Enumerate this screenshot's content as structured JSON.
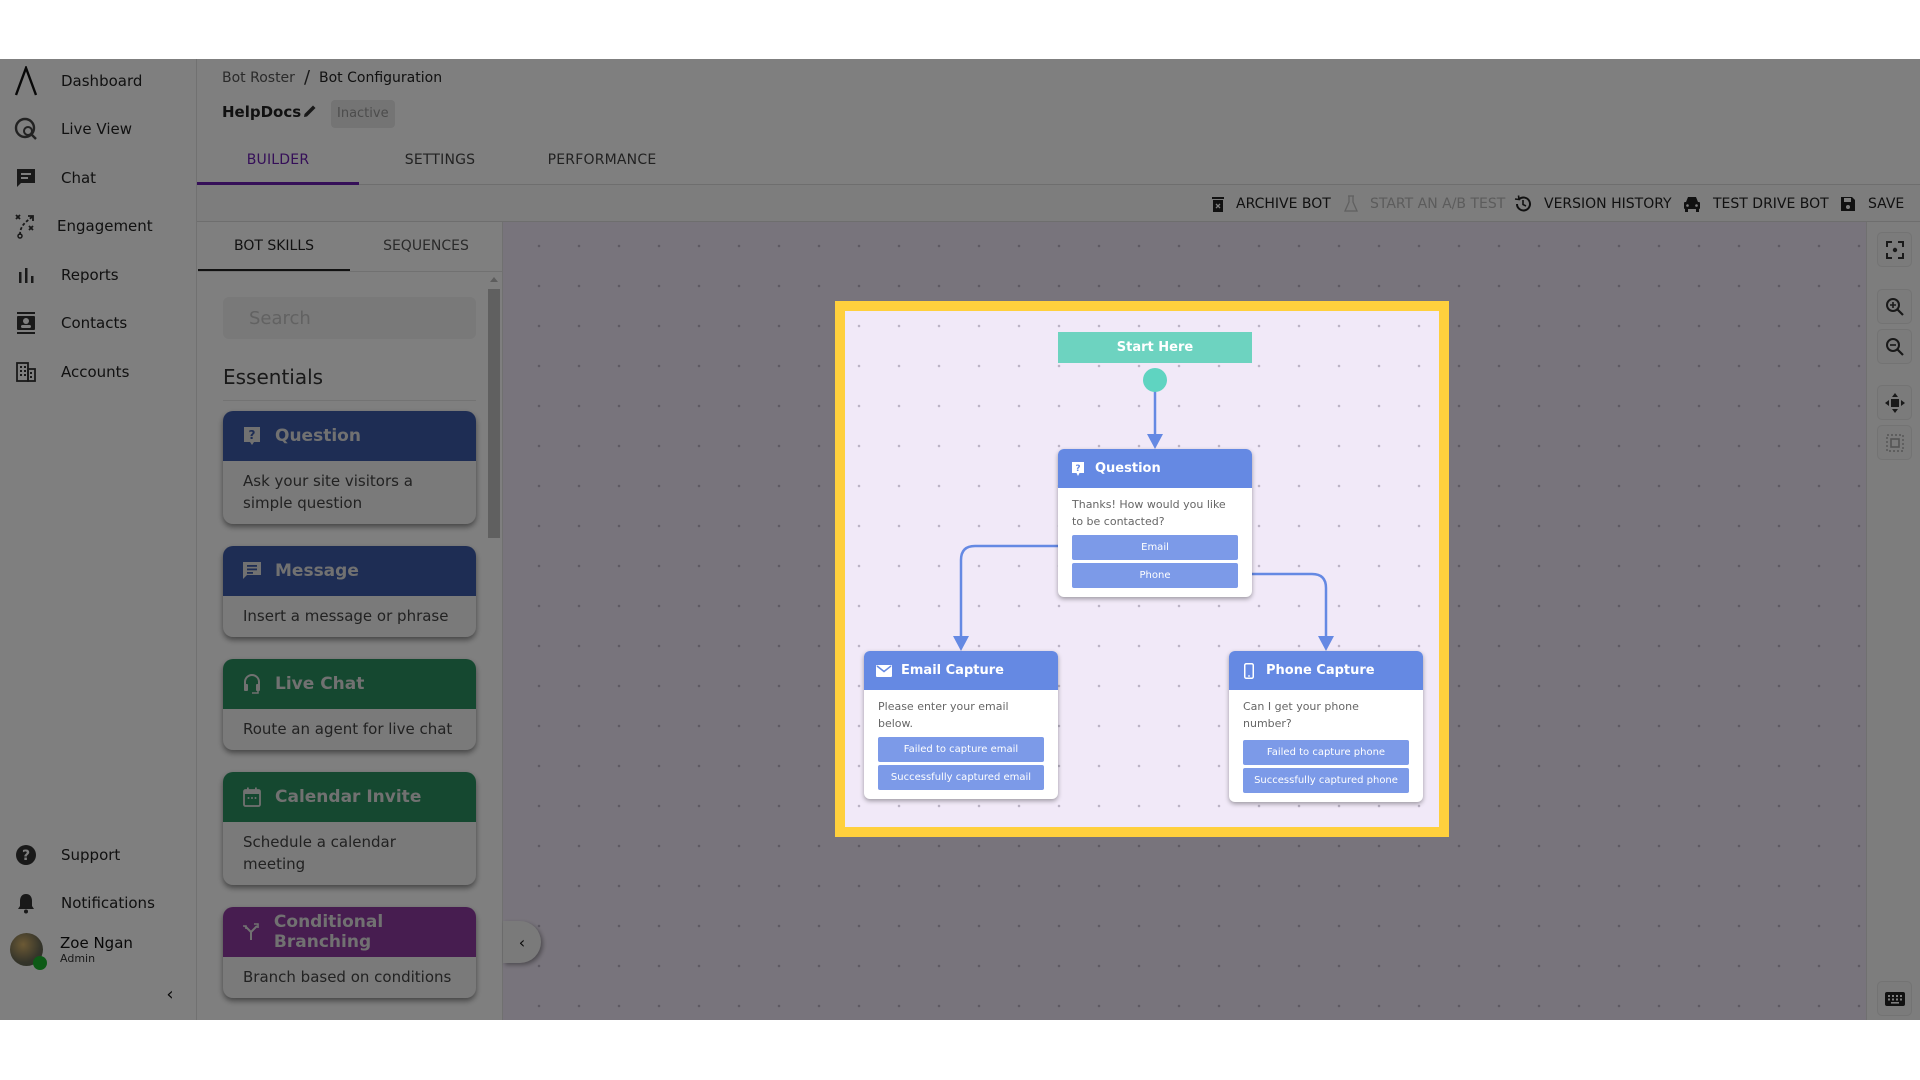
{
  "sidebar": {
    "items": [
      {
        "label": "Dashboard",
        "icon": "logo-icon"
      },
      {
        "label": "Live View",
        "icon": "live-view-icon"
      },
      {
        "label": "Chat",
        "icon": "chat-icon"
      },
      {
        "label": "Engagement",
        "icon": "engagement-icon"
      },
      {
        "label": "Reports",
        "icon": "bar-chart-icon"
      },
      {
        "label": "Contacts",
        "icon": "contacts-icon"
      },
      {
        "label": "Accounts",
        "icon": "building-icon"
      }
    ],
    "bottom_items": [
      {
        "label": "Support",
        "icon": "help-icon"
      },
      {
        "label": "Notifications",
        "icon": "bell-icon"
      }
    ],
    "user": {
      "name": "Zoe Ngan",
      "role": "Admin",
      "status_color": "#1bb52d"
    },
    "collapse_icon": "‹"
  },
  "header": {
    "breadcrumb": [
      "Bot Roster",
      "Bot Configuration"
    ],
    "breadcrumb_separator": "/",
    "bot_name": "HelpDocs",
    "status": "Inactive",
    "tabs": [
      {
        "label": "BUILDER",
        "active": true
      },
      {
        "label": "SETTINGS",
        "active": false
      },
      {
        "label": "PERFORMANCE",
        "active": false
      }
    ],
    "accent_color": "#6a1fb1"
  },
  "toolbar": {
    "archive": "ARCHIVE BOT",
    "ab_test": "START AN A/B TEST",
    "version_history": "VERSION HISTORY",
    "test_drive": "TEST DRIVE BOT",
    "save": "SAVE"
  },
  "panel": {
    "tabs": [
      {
        "label": "BOT SKILLS",
        "active": true
      },
      {
        "label": "SEQUENCES",
        "active": false
      }
    ],
    "search_placeholder": "Search",
    "section_title": "Essentials",
    "skills": [
      {
        "title": "Question",
        "desc": "Ask your site visitors a simple question",
        "color": "#3d5aa8",
        "icon": "question-icon"
      },
      {
        "title": "Message",
        "desc": "Insert a message or phrase",
        "color": "#3d5aa8",
        "icon": "message-icon"
      },
      {
        "title": "Live Chat",
        "desc": "Route an agent for live chat",
        "color": "#2a9160",
        "icon": "headset-icon"
      },
      {
        "title": "Calendar Invite",
        "desc": "Schedule a calendar meeting",
        "color": "#2a9160",
        "icon": "calendar-icon"
      },
      {
        "title": "Conditional Branching",
        "desc": "Branch based on conditions",
        "color": "#8e3aa0",
        "icon": "branch-icon"
      }
    ]
  },
  "flow": {
    "start_label": "Start Here",
    "start_color": "#6dd3c0",
    "node_color": "#6589e3",
    "highlight_color": "#ffd03d",
    "nodes": [
      {
        "id": "question",
        "title": "Question",
        "text": "Thanks! How would you like to be contacted?",
        "buttons": [
          "Email",
          "Phone"
        ]
      },
      {
        "id": "email",
        "title": "Email Capture",
        "text": "Please enter your email below.",
        "buttons": [
          "Failed to capture email",
          "Successfully captured email"
        ]
      },
      {
        "id": "phone",
        "title": "Phone Capture",
        "text": "Can I get your phone number?",
        "buttons": [
          "Failed to capture phone",
          "Successfully captured phone"
        ]
      }
    ]
  },
  "canvas_tools": [
    "fit-view-icon",
    "zoom-in-icon",
    "zoom-out-icon",
    "pan-icon",
    "select-area-icon",
    "keyboard-icon",
    "fullscreen-icon"
  ]
}
